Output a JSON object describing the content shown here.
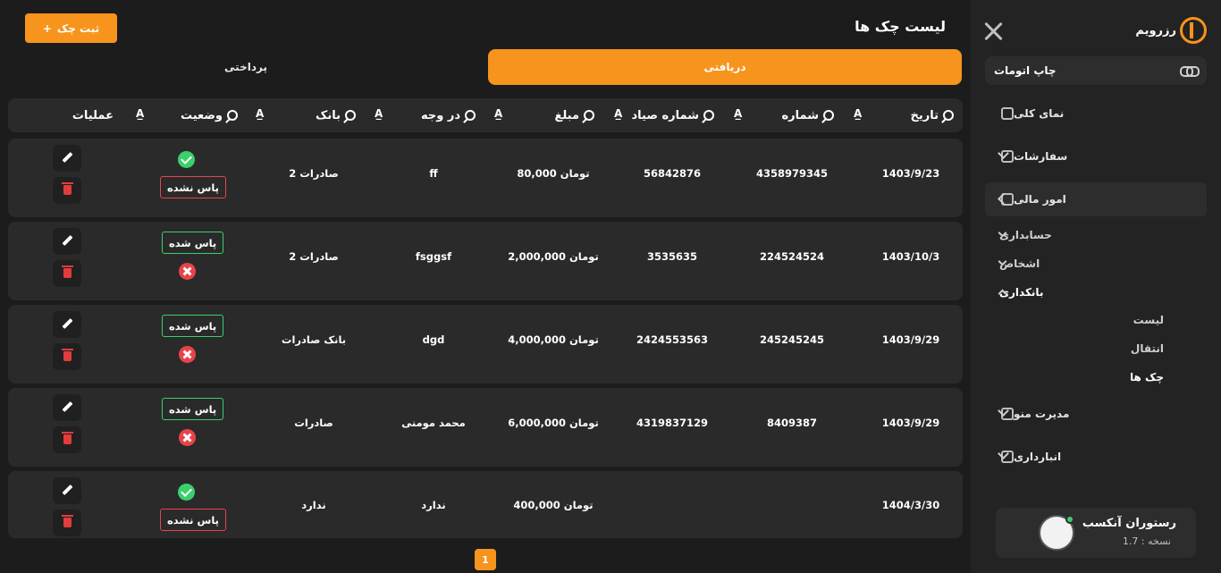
{
  "sidebar": {
    "logo_text": "رزرویم",
    "auto_print": "چاپ اتومات",
    "items": [
      {
        "label": "نمای کلی"
      },
      {
        "label": "سفارشات"
      },
      {
        "label": "امور مالی"
      },
      {
        "label": "مدیرت منو"
      },
      {
        "label": "انبارداری"
      }
    ],
    "finance_sub": [
      {
        "label": "حسابداری"
      },
      {
        "label": "اشخاص"
      },
      {
        "label": "بانکداری"
      }
    ],
    "banking_leaves": [
      {
        "label": "لیست"
      },
      {
        "label": "انتقال"
      },
      {
        "label": "چک ها"
      }
    ],
    "profile": {
      "name": "رستوران آنکسب",
      "version": "نسخه : 1.7"
    }
  },
  "main": {
    "title": "لیست چک ها",
    "add_button": "ثبت چک",
    "tabs": [
      {
        "label": "دریافتی"
      },
      {
        "label": "پرداختی"
      }
    ],
    "columns": [
      "تاریخ",
      "شماره",
      "شماره صیاد",
      "مبلغ",
      "در وجه",
      "بانک",
      "وضعیت",
      "عملیات"
    ],
    "rows": [
      {
        "date": "1403/9/23",
        "number": "4358979345",
        "sayad": "56842876",
        "amount": "80,000 تومان",
        "payee": "ff",
        "bank": "صادرات 2",
        "status": "پاس نشده"
      },
      {
        "date": "1403/10/3",
        "number": "224524524",
        "sayad": "3535635",
        "amount": "2,000,000 تومان",
        "payee": "fsggsf",
        "bank": "صادرات 2",
        "status": "پاس شده"
      },
      {
        "date": "1403/9/29",
        "number": "245245245",
        "sayad": "2424553563",
        "amount": "4,000,000 تومان",
        "payee": "dgd",
        "bank": "بانک صادرات",
        "status": "پاس شده"
      },
      {
        "date": "1403/9/29",
        "number": "8409387",
        "sayad": "4319837129",
        "amount": "6,000,000 تومان",
        "payee": "محمد مومنی",
        "bank": "صادرات",
        "status": "پاس شده"
      },
      {
        "date": "1404/3/30",
        "number": "",
        "sayad": "",
        "amount": "400,000 تومان",
        "payee": "ندارد",
        "bank": "ندارد",
        "status": "پاس نشده"
      }
    ],
    "page": "1"
  },
  "colors": {
    "accent": "#f7941d",
    "success": "#3ad06b",
    "danger": "#e8434a"
  }
}
